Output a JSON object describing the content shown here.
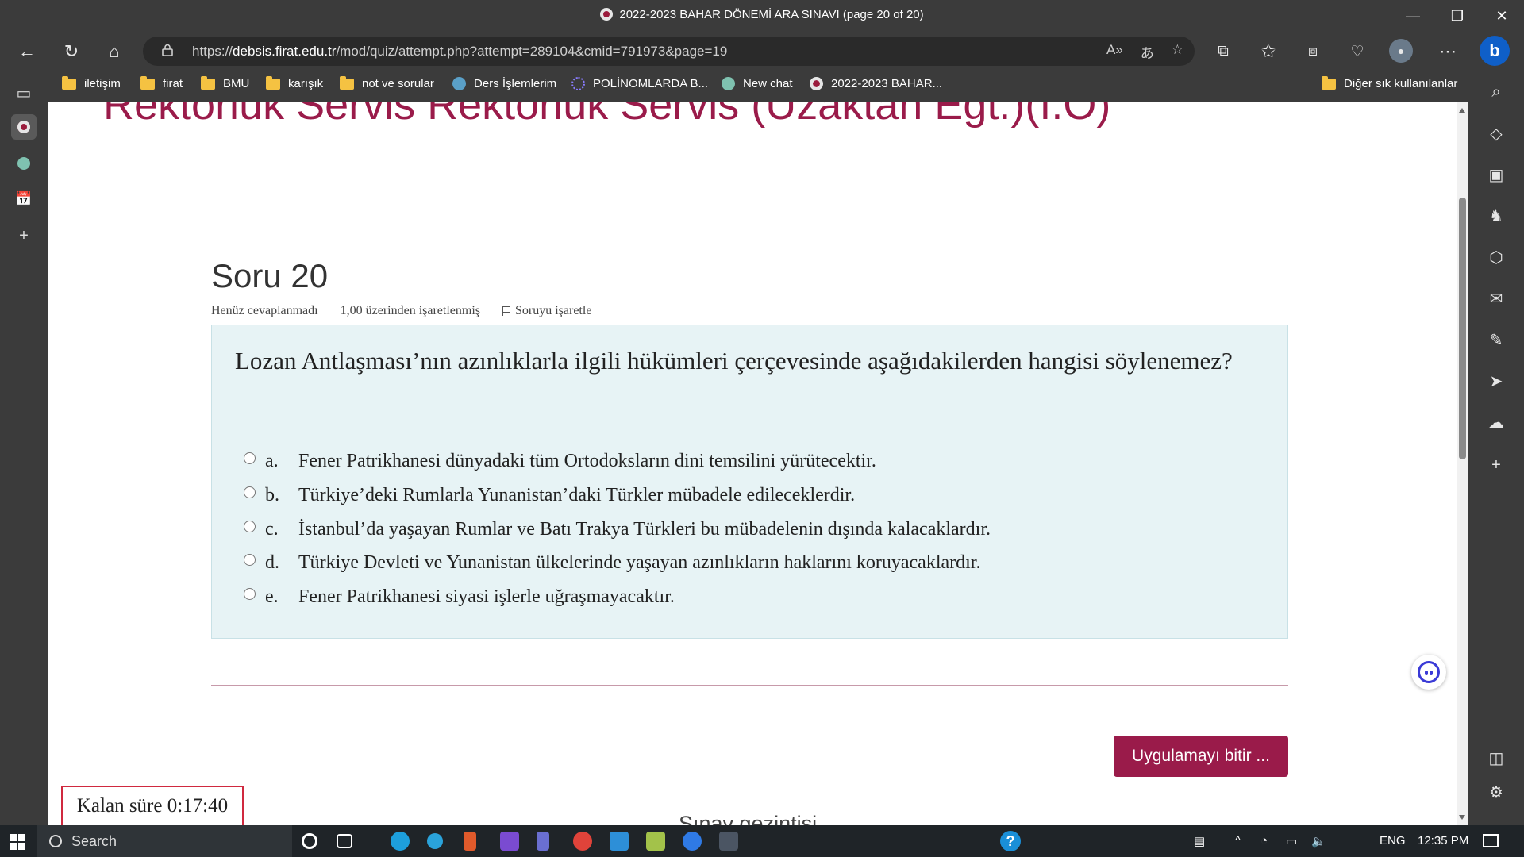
{
  "window": {
    "title": "2022-2023 BAHAR DÖNEMİ ARA SINAVI (page 20 of 20)"
  },
  "address_bar": {
    "url_prefix": "https://",
    "url_domain": "debsis.firat.edu.tr",
    "url_path": "/mod/quiz/attempt.php?attempt=289104&cmid=791973&page=19"
  },
  "bookmarks": [
    "iletişim",
    "firat",
    "BMU",
    "karışık",
    "not ve sorular",
    "Ders İşlemlerim",
    "POLİNOMLARDA B...",
    "New chat",
    "2022-2023 BAHAR..."
  ],
  "bookmarks_other": "Diğer sık kullanılanlar",
  "course_title": "Rektörlük Servis Rektörlük Servis (Uzaktan Egt.)(I.O)",
  "question": {
    "title": "Soru 20",
    "status": "Henüz cevaplanmadı",
    "mark": "1,00 üzerinden işaretlenmiş",
    "flag_label": "Soruyu işaretle",
    "text": "Lozan Antlaşması’nın azınlıklarla ilgili hükümleri çerçevesinde aşağıdakilerden hangisi söylenemez?",
    "options": [
      {
        "letter": "a.",
        "text": "Fener Patrikhanesi dünyadaki tüm Ortodoksların dini temsilini yürütecektir."
      },
      {
        "letter": "b.",
        "text": "Türkiye’deki Rumlarla Yunanistan’daki Türkler mübadele edileceklerdir."
      },
      {
        "letter": "c.",
        "text": "İstanbul’da yaşayan Rumlar ve Batı Trakya Türkleri bu mübadelenin dışında kalacaklardır."
      },
      {
        "letter": "d.",
        "text": "Türkiye Devleti ve Yunanistan ülkelerinde yaşayan azınlıkların haklarını koruyacaklardır."
      },
      {
        "letter": "e.",
        "text": "Fener Patrikhanesi siyasi işlerle uğraşmayacaktır."
      }
    ]
  },
  "finish_button": "Uygulamayı bitir ...",
  "timer": "Kalan süre 0:17:40",
  "quiz_nav": "Sınav gezintisi",
  "taskbar": {
    "search": "Search",
    "lang": "ENG",
    "time": "12:35 PM"
  },
  "colors": {
    "accent": "#9a1b4a",
    "question_bg": "#e7f3f5",
    "timer_border": "#d0293f"
  }
}
